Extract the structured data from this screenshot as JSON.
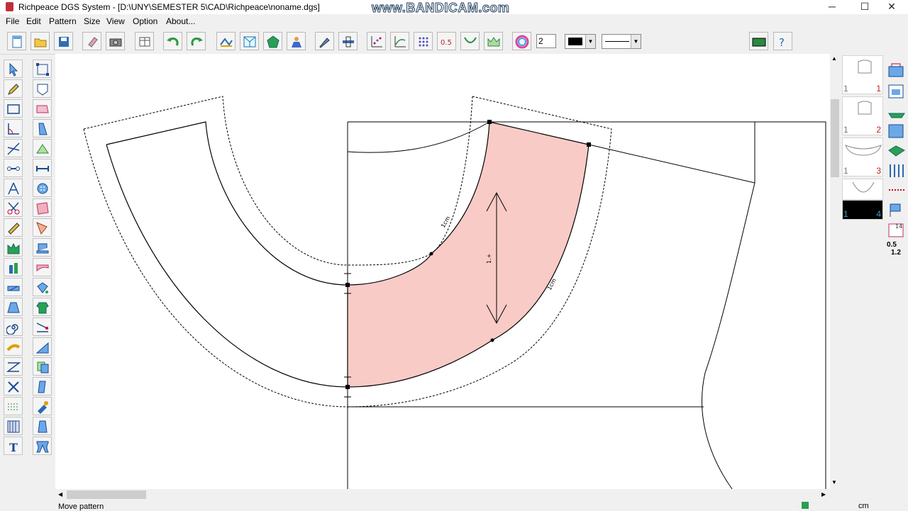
{
  "window": {
    "title": "Richpeace DGS System - [D:\\UNY\\SEMESTER 5\\CAD\\Richpeace\\noname.dgs]",
    "watermark": "www.BANDICAM.com",
    "minimize": "─",
    "maximize": "☐",
    "close": "✕"
  },
  "menu": [
    "File",
    "Edit",
    "Pattern",
    "Size",
    "View",
    "Option",
    "About..."
  ],
  "toolbar": {
    "step_value": "2",
    "color_value": "",
    "line_style": "",
    "step_label": "0.5"
  },
  "canvas": {
    "label_1cm_inner": "1cm",
    "label_1cm_outer": "1cm",
    "label_arrow": "1.+"
  },
  "pieces": [
    {
      "qty_a": "1",
      "qty_b": "1"
    },
    {
      "qty_a": "1",
      "qty_b": "2"
    },
    {
      "qty_a": "1",
      "qty_b": "3"
    },
    {
      "qty_a": "1",
      "qty_b": "4"
    }
  ],
  "right_tools": {
    "scale_a": "0.5",
    "scale_b": "1.2",
    "num": "14"
  },
  "status": {
    "message": "Move pattern",
    "unit": "cm"
  },
  "colors": {
    "fill_highlight": "#f9cbc6",
    "selected_thumb": "#000000"
  }
}
